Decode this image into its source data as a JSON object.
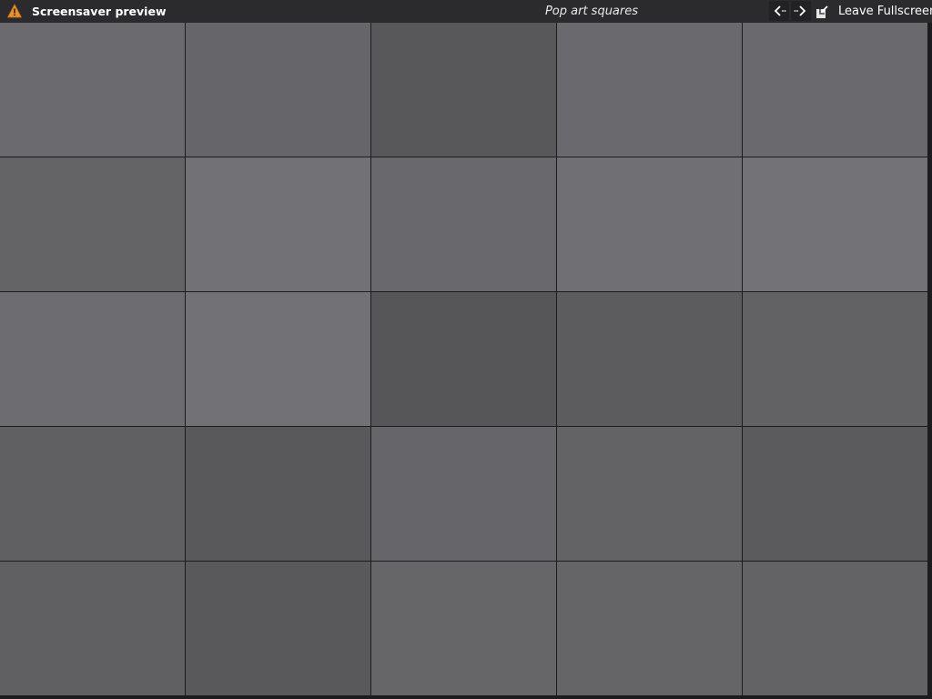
{
  "titlebar": {
    "app_title": "Screensaver preview",
    "preview_name": "Pop art squares",
    "leave_label": "Leave Fullscreen",
    "icons": {
      "warning": "warning-icon",
      "prev": "arrow-left-icon",
      "next": "arrow-right-icon",
      "leave": "leave-fullscreen-icon"
    },
    "accent_color": "#e8902c"
  },
  "preview": {
    "rows": 5,
    "cols": 5,
    "tile_colors": [
      [
        "#6b6a6e",
        "#666569",
        "#58585a",
        "#6a696d",
        "#6a696d"
      ],
      [
        "#646366",
        "#727175",
        "#69686c",
        "#706f73",
        "#737276"
      ],
      [
        "#6d6c70",
        "#727175",
        "#565658",
        "#5c5c5e",
        "#626164"
      ],
      [
        "#606062",
        "#59595b",
        "#666569",
        "#636265",
        "#5b5b5d"
      ],
      [
        "#606062",
        "#59595b",
        "#666568",
        "#656467",
        "#636265"
      ]
    ]
  }
}
